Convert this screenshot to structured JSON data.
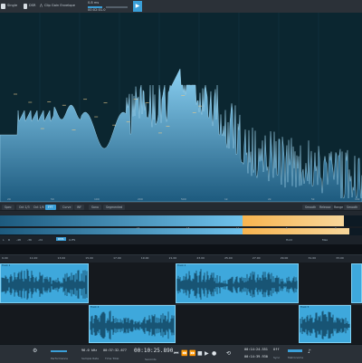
{
  "toolbar": {
    "item1": "Single",
    "item2": "DSR",
    "item3": "Clip Gain Envelope",
    "time1": "0.8 ms",
    "time2": "00:02:01.0",
    "play_icon": "play-icon",
    "accent": "#3a9fd8"
  },
  "spectrum": {
    "fill_top": "#8ad0f2",
    "fill_bottom": "#1d5a7e",
    "background": "#0b2630"
  },
  "freq_axis": {
    "labels": [
      "20",
      "50",
      "100",
      "200",
      "500",
      "1k",
      "2k",
      "5k",
      "10k"
    ]
  },
  "analyzer_tabs": [
    {
      "label": "Spec",
      "active": false
    },
    {
      "label": "Oct 1/3",
      "active": false
    },
    {
      "label": "Oct 1/6",
      "active": false
    },
    {
      "label": "FFT",
      "active": true
    },
    {
      "label": "Curve",
      "active": false
    },
    {
      "label": "WF",
      "active": false
    },
    {
      "label": "Sono",
      "active": false
    },
    {
      "label": "Segmented",
      "active": false
    }
  ],
  "analyzer_right": {
    "label1": "Smooth",
    "label2": "Release",
    "range_label": "Range",
    "range_value": "Smooth",
    "hold_label": "Hold",
    "max_label": "Max"
  },
  "meter_scale": [
    "-24",
    "-18",
    "-12",
    "-6",
    "0"
  ],
  "meter_left_labels": [
    "L",
    "R"
  ],
  "meter_sub_labels": [
    "-48",
    "-36",
    "-24",
    "RMS",
    "LUFS"
  ],
  "meter_level": 0.67,
  "meter_peak": 0.95,
  "ruler": {
    "ticks": [
      "9.00",
      "11.00",
      "13.00",
      "15.00",
      "17.00",
      "19.00",
      "21.00",
      "23.00",
      "25.00",
      "27.00",
      "29.00",
      "31.00",
      "33.00"
    ]
  },
  "clips": {
    "names": [
      "Track 1",
      "Track 2",
      "Track 3",
      "Track 4",
      "Track 5"
    ]
  },
  "transport": {
    "perf_label": "Performance",
    "rate": "96.0 kHz",
    "rate_label": "Sample Rate",
    "length": "00:37:32.677",
    "length_label": "Time Total",
    "position": "00:10:25.890",
    "position_label": "Seconds",
    "loop_start": "00:14:24.551",
    "loop_end": "00:14:39.930",
    "sync_label": "Off",
    "sync_sub": "Sync",
    "metronome": "Metronome"
  }
}
